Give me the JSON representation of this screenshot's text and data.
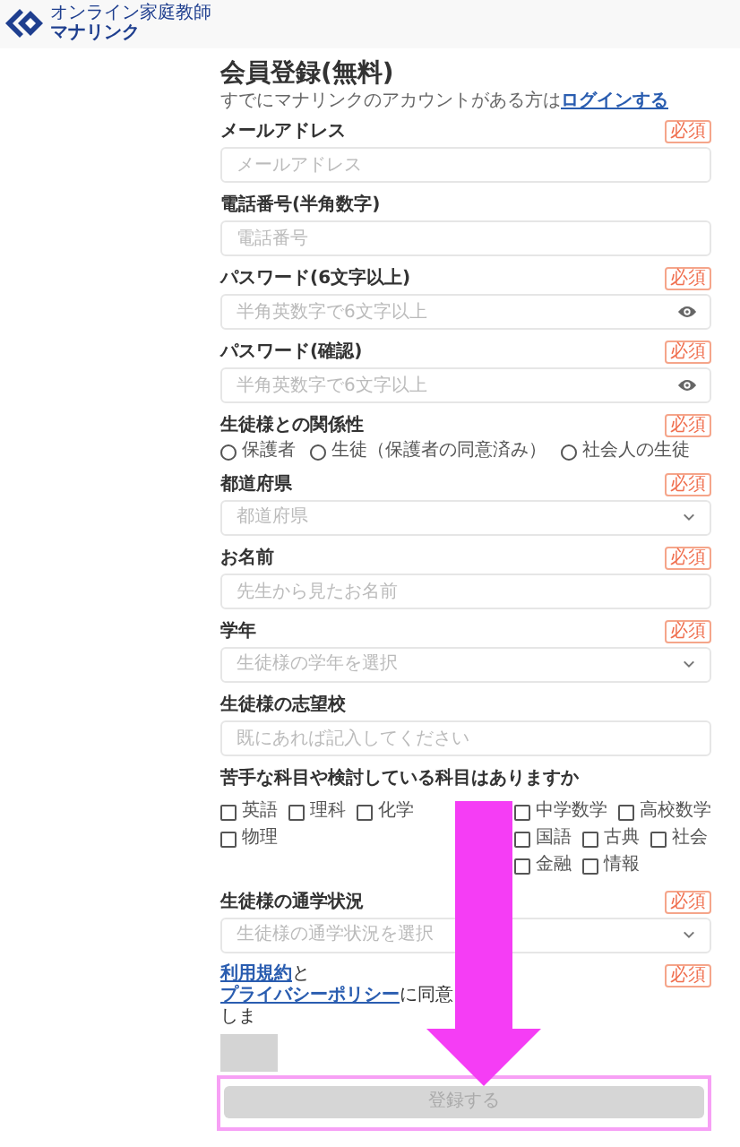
{
  "header": {
    "logo_tagline": "オンライン家庭教師",
    "logo_name": "マナリンク"
  },
  "form": {
    "title": "会員登録(無料)",
    "login_prompt": "すでにマナリンクのアカウントがある方は",
    "login_link": "ログインする",
    "fields": [
      {
        "kind": "text",
        "label": "メールアドレス",
        "badge": "必須",
        "placeholder": "メールアドレス"
      },
      {
        "kind": "text",
        "label": "電話番号(半角数字)",
        "placeholder": "電話番号"
      },
      {
        "kind": "password",
        "label": "パスワード(6文字以上)",
        "badge": "必須",
        "placeholder": "半角英数字で6文字以上"
      },
      {
        "kind": "password",
        "label": "パスワード(確認)",
        "badge": "必須",
        "placeholder": "半角英数字で6文字以上"
      },
      {
        "kind": "radio",
        "label": "生徒様との関係性",
        "badge": "必須",
        "options": [
          {
            "label": "保護者",
            "selected": false
          },
          {
            "label": "生徒（保護者の同意済み）",
            "selected": false
          },
          {
            "label": "社会人の生徒",
            "selected": false
          }
        ]
      },
      {
        "kind": "select",
        "label": "都道府県",
        "badge": "必須",
        "placeholder": "都道府県"
      },
      {
        "kind": "text",
        "label": "お名前",
        "badge": "必須",
        "placeholder": "先生から見たお名前"
      },
      {
        "kind": "select",
        "label": "学年",
        "badge": "必須",
        "placeholder": "生徒様の学年を選択"
      },
      {
        "kind": "text",
        "label": "生徒様の志望校",
        "placeholder": "既にあれば記入してください"
      },
      {
        "kind": "checkboxes",
        "label": "苦手な科目や検討している科目はありますか",
        "options": [
          {
            "label": "英語",
            "checked": false
          },
          {
            "label": "理科",
            "checked": false
          },
          {
            "label": "化学",
            "checked": false
          },
          {
            "label": "物理",
            "checked": false
          },
          {
            "label": "中学数学",
            "checked": false
          },
          {
            "label": "高校数学",
            "checked": false
          },
          {
            "label": "国語",
            "checked": false
          },
          {
            "label": "古典",
            "checked": false
          },
          {
            "label": "社会",
            "checked": false
          },
          {
            "label": "金融",
            "checked": false
          },
          {
            "label": "情報",
            "checked": false
          }
        ]
      },
      {
        "kind": "select",
        "label": "生徒様の通学状況",
        "badge": "必須",
        "placeholder": "生徒様の通学状況を選択"
      }
    ],
    "terms": {
      "terms_link": "利用規約",
      "joiner": "と",
      "privacy_link": "プライバシーポリシー",
      "rest": "に同意しま",
      "badge": "必須",
      "checked": false
    },
    "submit": {
      "label": "登録する",
      "disabled": true
    }
  }
}
